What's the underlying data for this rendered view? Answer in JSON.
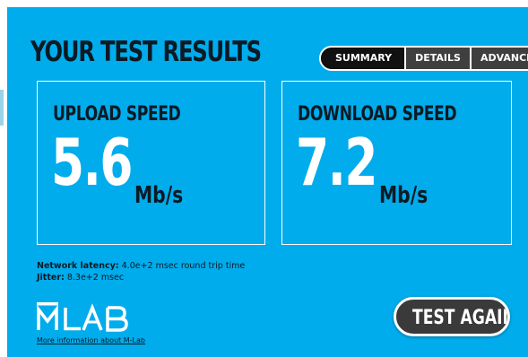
{
  "header": {
    "title": "YOUR TEST RESULTS"
  },
  "tabs": [
    {
      "label": "SUMMARY",
      "active": true
    },
    {
      "label": "DETAILS",
      "active": false
    },
    {
      "label": "ADVANCED",
      "active": false
    }
  ],
  "upload": {
    "label": "UPLOAD SPEED",
    "value": "5.6",
    "unit": "Mb/s"
  },
  "download": {
    "label": "DOWNLOAD SPEED",
    "value": "7.2",
    "unit": "Mb/s"
  },
  "metrics": {
    "latency_label": "Network latency:",
    "latency_value": "4.0e+2 msec round trip time",
    "jitter_label": "Jitter:",
    "jitter_value": "8.3e+2 msec"
  },
  "footer": {
    "logo_text": "MLAB",
    "more_info_link": "More information about M-Lab",
    "test_again_label": "TEST AGAIN"
  },
  "colors": {
    "background": "#00acec",
    "text_dark": "#0b1a24",
    "value_white": "#ffffff",
    "tab_active": "#111111",
    "tab_inactive": "#3f3f3f",
    "button_bg": "#3a3a3a"
  }
}
